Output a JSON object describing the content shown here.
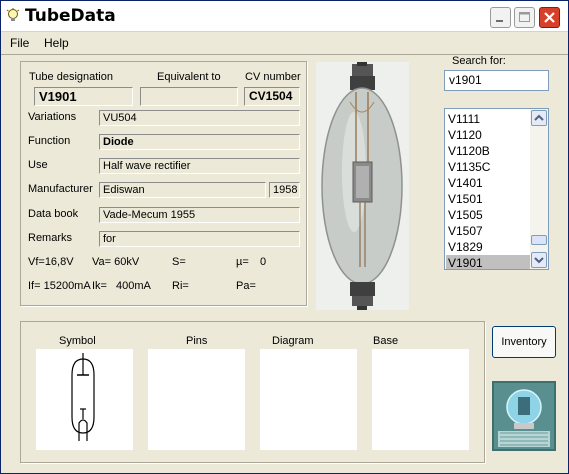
{
  "window": {
    "title": "TubeData",
    "app_icon": "lightbulb-icon"
  },
  "menu": {
    "file": "File",
    "help": "Help"
  },
  "form": {
    "designation_label": "Tube designation",
    "equivalent_label": "Equivalent to",
    "cv_label": "CV number",
    "designation_value": "V1901",
    "equivalent_value": "",
    "cv_value": "CV1504",
    "variations_label": "Variations",
    "variations_value": "VU504",
    "function_label": "Function",
    "function_value": "Diode",
    "use_label": "Use",
    "use_value": "Half wave rectifier",
    "manufacturer_label": "Manufacturer",
    "manufacturer_value": "Ediswan",
    "year_value": "1958",
    "databook_label": "Data book",
    "databook_value": "Vade-Mecum 1955",
    "remarks_label": "Remarks",
    "remarks_value": "for"
  },
  "params": {
    "vf": "Vf=16,8V",
    "va": "Va= 60kV",
    "s": "S=",
    "mu": "µ=",
    "mu_value": "0",
    "if": "If= 15200mA",
    "ik": "Ik=",
    "ik_value": "400mA",
    "ri": "Ri=",
    "pa": "Pa="
  },
  "search": {
    "label": "Search for:",
    "value": "v1901"
  },
  "tube_list": {
    "items": [
      "V1111",
      "V1120",
      "V1120B",
      "V1135C",
      "V1401",
      "V1501",
      "V1505",
      "V1507",
      "V1829",
      "V1901"
    ],
    "selected": "V1901"
  },
  "panels": {
    "symbol": "Symbol",
    "pins": "Pins",
    "diagram": "Diagram",
    "base": "Base"
  },
  "buttons": {
    "inventory": "Inventory"
  },
  "colors": {
    "title_bar": "#ffffff",
    "window_bg": "#ece9d8",
    "close_button": "#d6402a",
    "selection": "#c0c0c0"
  }
}
